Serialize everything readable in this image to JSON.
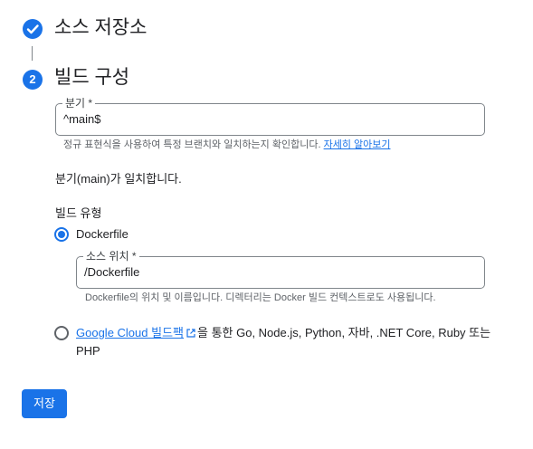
{
  "steps": {
    "step1": {
      "title": "소스 저장소",
      "status_icon": "check-icon"
    },
    "step2": {
      "number": "2",
      "title": "빌드 구성"
    }
  },
  "branch": {
    "label": "분기 *",
    "value": "^main$",
    "helper_text": "정규 표현식을 사용하여 특정 브랜치와 일치하는지 확인합니다.",
    "helper_link": "자세히 알아보기",
    "match_status": "분기(main)가 일치합니다."
  },
  "build_type": {
    "label": "빌드 유형",
    "options": [
      {
        "label": "Dockerfile",
        "selected": true
      },
      {
        "link_label": "Google Cloud 빌드팩",
        "link_icon": "open-in-new-icon",
        "text_after_link": "을 통한 Go, Node.js, Python, 자바, .NET Core, Ruby 또는",
        "text_line2": "PHP",
        "selected": false
      }
    ]
  },
  "source_location": {
    "label": "소스 위치 *",
    "value": "/Dockerfile",
    "helper_text": "Dockerfile의 위치 및 이름입니다. 디렉터리는 Docker 빌드 컨텍스트로도 사용됩니다."
  },
  "actions": {
    "save_label": "저장"
  },
  "colors": {
    "accent": "#1a73e8",
    "text": "#202124",
    "helper": "#5f6368",
    "border": "#80868b"
  }
}
